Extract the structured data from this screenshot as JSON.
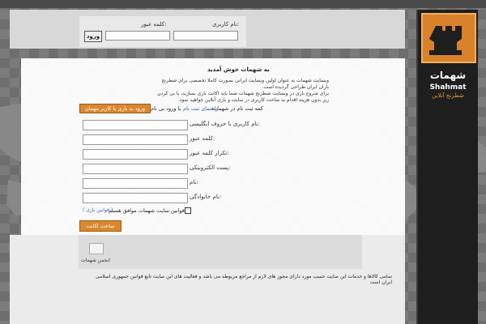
{
  "login": {
    "username_label": "نام کاربری:",
    "password_label": "کلمه عبور:",
    "submit_label": "ورود"
  },
  "brand": {
    "name_fa": "شهمات",
    "name_en": "Shahmat",
    "tagline": "شطرنج آنلاین",
    "logo_icon": "rook-icon",
    "accent": "#d9822b"
  },
  "main": {
    "welcome": "به شهمات خوش آمدید",
    "intro_line1": "وبسایت شهمات به عنوان اولین وبسایت ایرانی بصورت کاملا تخصصی برای شطرنج",
    "intro_line2": "بازان ایران طراحی گردیده است.",
    "intro_line3": "برای شروع بازی در وبسایت شطرنج شهمات شما باید اکانت بازی بسازید، یا بی کردن",
    "intro_line4": "زیر بدون هزینه اقدام به ساخت کاربری در سایت و بازی آنلاین خواهید نمود.",
    "guest_text": "کمه ثبت نام در شهمات",
    "guide_link": "راهنمای ثبت نام",
    "login_guest_text": "یا ورود بی نام",
    "guest_button": "ورود به بازی با کاربر مهمان",
    "fields": [
      {
        "label": "نام کاربری با حروف انگلیسی:"
      },
      {
        "label": "کلمه عبور:"
      },
      {
        "label": "تکرار کلمه عبور:"
      },
      {
        "label": "پست الکترونیکی:"
      },
      {
        "label": "نام:"
      },
      {
        "label": "نام خانوادگی:"
      }
    ],
    "rules_text": "قوانین سایت شهمات موافق هستم",
    "rules_link": "( قوانین بازی )",
    "create_button": "ساخت اکانت"
  },
  "footer": {
    "badge_text": "انجمن شهمات",
    "copyright": "تمامی کالاها و خدمات این سایت حسب مورد دارای مجوز های لازم از مراجع مربوطه می باشد و فعالیت های این سایت تابع قوانین جمهوری اسلامی ایران است"
  }
}
